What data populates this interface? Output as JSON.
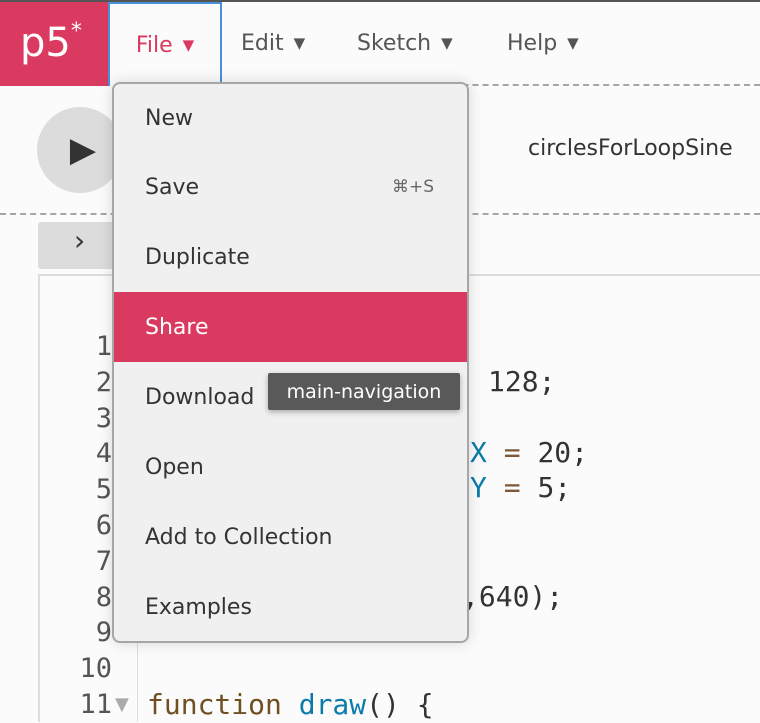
{
  "nav": {
    "logo": "p5",
    "logo_mark": "*",
    "items": [
      {
        "label": "File"
      },
      {
        "label": "Edit"
      },
      {
        "label": "Sketch"
      },
      {
        "label": "Help"
      }
    ],
    "caret": "▼"
  },
  "toolbar": {
    "play": "▶",
    "sketch_name": "circlesForLoopSine"
  },
  "sidebar_toggle": "›",
  "editor": {
    "line_numbers": [
      "1",
      "2",
      "3",
      "4",
      "5",
      "6",
      "7",
      "8",
      "9",
      "10",
      "11"
    ],
    "fragments": {
      "l2": "128;",
      "l4_var": "X",
      "l4_op": "=",
      "l4_val": "20;",
      "l5_var": "Y",
      "l5_op": "=",
      "l5_val": "5;",
      "l8": ",640);",
      "l11_kw": "function",
      "l11_fn": "draw",
      "l11_rest": "() {"
    }
  },
  "file_menu": {
    "items": [
      {
        "label": "New"
      },
      {
        "label": "Save",
        "shortcut": "⌘+S"
      },
      {
        "label": "Duplicate"
      },
      {
        "label": "Share",
        "active": true
      },
      {
        "label": "Download"
      },
      {
        "label": "Open"
      },
      {
        "label": "Add to Collection"
      },
      {
        "label": "Examples"
      }
    ]
  },
  "tooltip": "main-navigation",
  "colors": {
    "accent": "#db3a60",
    "focus": "#4a90d9"
  }
}
